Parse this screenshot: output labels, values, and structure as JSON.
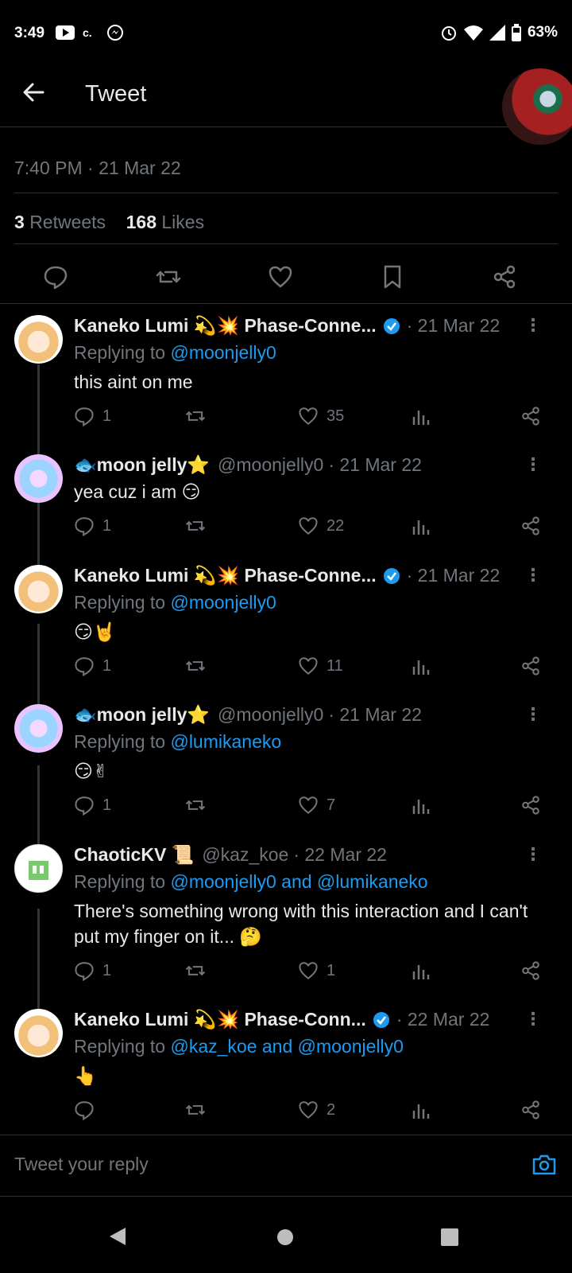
{
  "status_bar": {
    "time": "3:49",
    "battery": "63%",
    "left_icons": [
      "youtube-icon",
      "carrier-icon",
      "messenger-icon"
    ],
    "right_icons": [
      "alarm-icon",
      "wifi-icon",
      "signal-icon",
      "battery-icon"
    ]
  },
  "header": {
    "title": "Tweet"
  },
  "tweet": {
    "timestamp": "7:40 PM · 21 Mar 22",
    "retweets_count": "3",
    "retweets_label": "Retweets",
    "likes_count": "168",
    "likes_label": "Likes"
  },
  "replies": [
    {
      "name": "Kaneko Lumi 💫💥 Phase-Conne...",
      "verified": true,
      "handle": "",
      "date": "· 21 Mar 22",
      "replying_prefix": "Replying to ",
      "replying_to": "@moonjelly0",
      "text": "this aint on me",
      "reply_count": "1",
      "like_count": "35"
    },
    {
      "name": "🐟moon jelly⭐",
      "verified": false,
      "handle": "@moonjelly0",
      "date": "· 21 Mar 22",
      "replying_prefix": "",
      "replying_to": "",
      "text": "yea cuz i am 😏",
      "reply_count": "1",
      "like_count": "22"
    },
    {
      "name": "Kaneko Lumi 💫💥 Phase-Conne...",
      "verified": true,
      "handle": "",
      "date": "· 21 Mar 22",
      "replying_prefix": "Replying to ",
      "replying_to": "@moonjelly0",
      "text": "😏🤘",
      "reply_count": "1",
      "like_count": "11"
    },
    {
      "name": "🐟moon jelly⭐",
      "verified": false,
      "handle": "@moonjelly0",
      "date": "· 21 Mar 22",
      "replying_prefix": "Replying to ",
      "replying_to": "@lumikaneko",
      "text": "😏✌",
      "reply_count": "1",
      "like_count": "7"
    },
    {
      "name": "ChaoticKV 📜",
      "verified": false,
      "handle": "@kaz_koe",
      "date": "· 22 Mar 22",
      "replying_prefix": "Replying to ",
      "replying_to": "@moonjelly0 and @lumikaneko",
      "text": "There's something wrong with this interaction and I can't put my finger on it... 🤔",
      "reply_count": "1",
      "like_count": "1"
    },
    {
      "name": "Kaneko Lumi 💫💥 Phase-Conn...",
      "verified": true,
      "handle": "",
      "date": "· 22 Mar 22",
      "replying_prefix": "Replying to ",
      "replying_to": "@kaz_koe and @moonjelly0",
      "text": "👆",
      "reply_count": "",
      "like_count": "2"
    }
  ],
  "composer": {
    "placeholder": "Tweet your reply"
  },
  "colors": {
    "background": "#000000",
    "text_primary": "#e7e9ea",
    "text_secondary": "#71767b",
    "link": "#1d9bf0",
    "divider": "#2f3336"
  }
}
